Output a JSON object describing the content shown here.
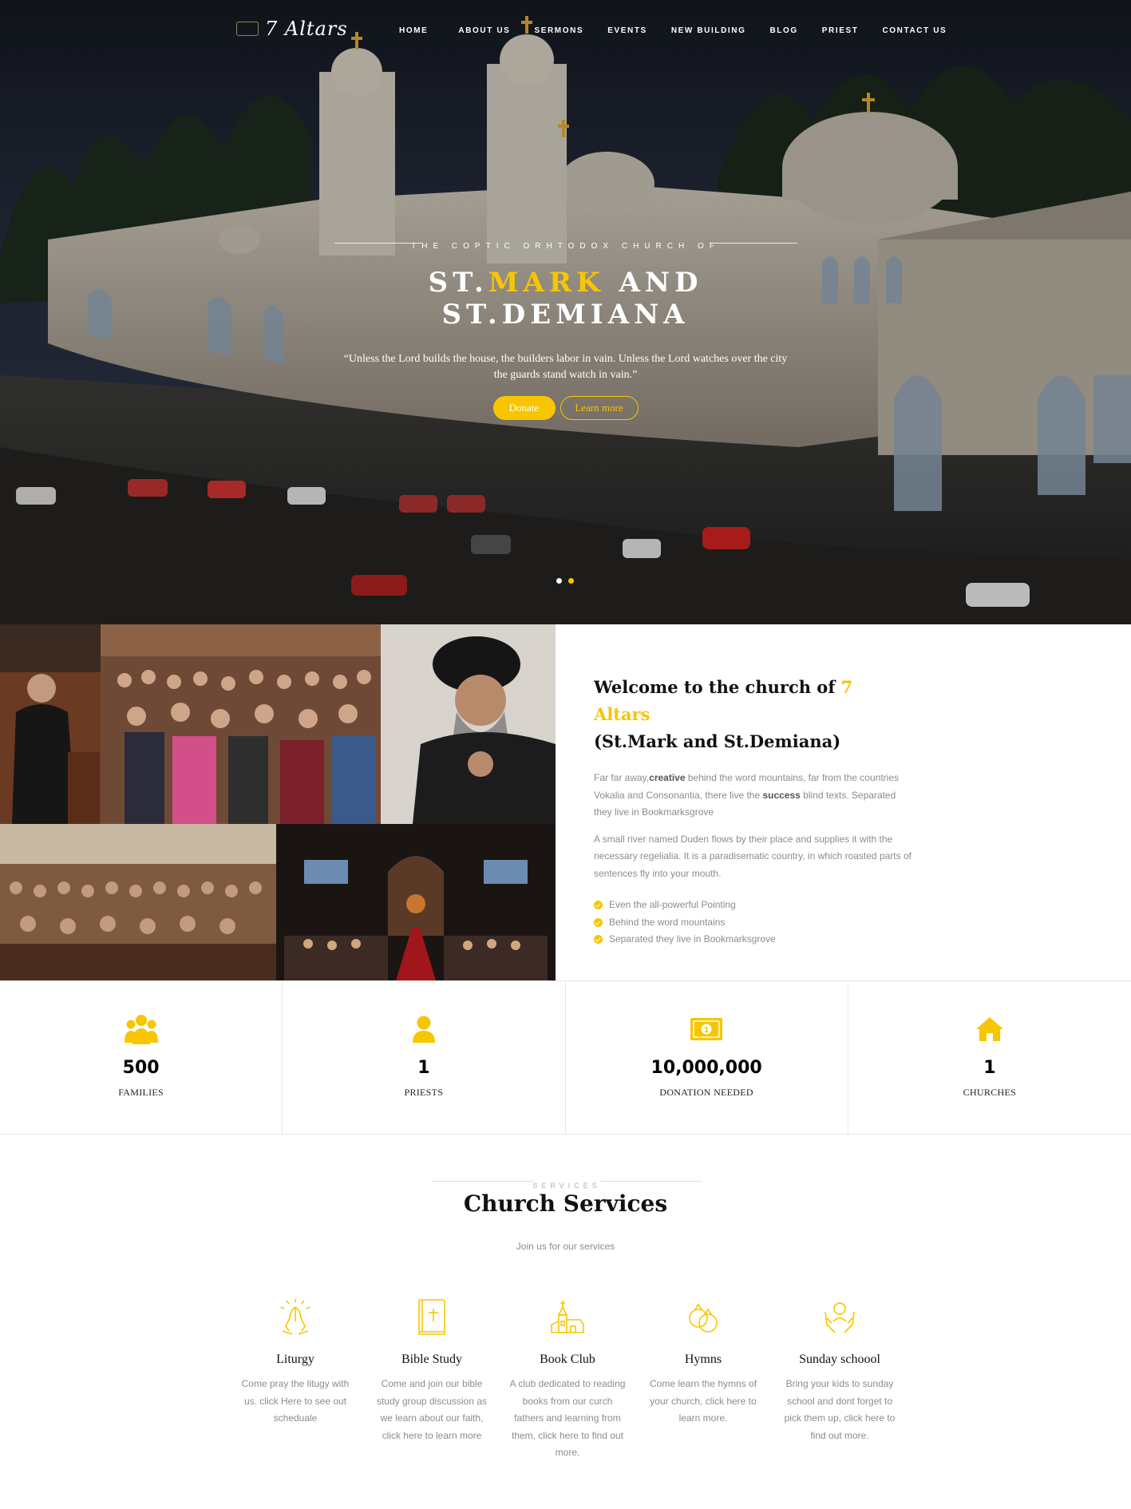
{
  "brand": {
    "logo_text": "7 Altars"
  },
  "nav": {
    "items": [
      "HOME",
      "ABOUT US",
      "SERMONS",
      "EVENTS",
      "NEW BUILDING",
      "BLOG",
      "PRIEST",
      "CONTACT US"
    ]
  },
  "hero": {
    "eyebrow": "THE COPTIC ORHTODOX CHURCH OF",
    "title_line1_a": "ST.",
    "title_line1_accent": "MARK",
    "title_line1_b": " AND",
    "title_line2": "ST.DEMIANA",
    "quote": "“Unless the Lord builds the house, the builders labor in vain. Unless the Lord watches over the city the guards stand watch in vain.”",
    "donate_label": "Donate",
    "learn_label": "Learn more",
    "slides": 2,
    "active_slide": 2
  },
  "welcome": {
    "title_a": "Welcome to the church of ",
    "title_accent": "7 Altars",
    "title_b": "(St.Mark and St.Demiana)",
    "p1_a": "Far far away,",
    "p1_b1": "creative",
    "p1_c": " behind the word mountains, far from the countries Vokalia and Consonantia, there live the ",
    "p1_b2": "success",
    "p1_d": " blind texts. Separated they live in Bookmarksgrove",
    "p2": "A small river named Duden flows by their place and supplies it with the necessary regelialia. It is a paradisematic country, in which roasted parts of sentences fly into your mouth.",
    "checks": [
      "Even the all-powerful Pointing",
      "Behind the word mountains",
      "Separated they live in Bookmarksgrove"
    ]
  },
  "stats": [
    {
      "icon": "group-icon",
      "number": "500",
      "label": "FAMILIES"
    },
    {
      "icon": "person-icon",
      "number": "1",
      "label": "PRIESTS"
    },
    {
      "icon": "money-icon",
      "number": "10,000,000",
      "label": "DONATION NEEDED"
    },
    {
      "icon": "home-icon",
      "number": "1",
      "label": "CHURCHES"
    }
  ],
  "services": {
    "eyebrow": "SERVICES",
    "title": "Church Services",
    "subtitle": "Join us for our services",
    "items": [
      {
        "icon": "praying-hands-icon",
        "name": "Liturgy",
        "desc": "Come pray the litugy with us. click Here to see out scheduale"
      },
      {
        "icon": "bible-icon",
        "name": "Bible Study",
        "desc": "Come and join our bible study group discussion as we learn about our faith, click here to learn more"
      },
      {
        "icon": "church-icon",
        "name": "Book Club",
        "desc": "A club dedicated to reading books from our curch fathers and learning from them, click here to find out more."
      },
      {
        "icon": "rings-icon",
        "name": "Hymns",
        "desc": "Come learn the hymns of your church, click here to learn more."
      },
      {
        "icon": "child-hands-icon",
        "name": "Sunday schoool",
        "desc": "Bring your kids to sunday school and dont forget to pick them up, click here to find out more."
      }
    ]
  },
  "colors": {
    "accent": "#f7c600",
    "text_muted": "#8c8c8c",
    "dark": "#111111"
  }
}
